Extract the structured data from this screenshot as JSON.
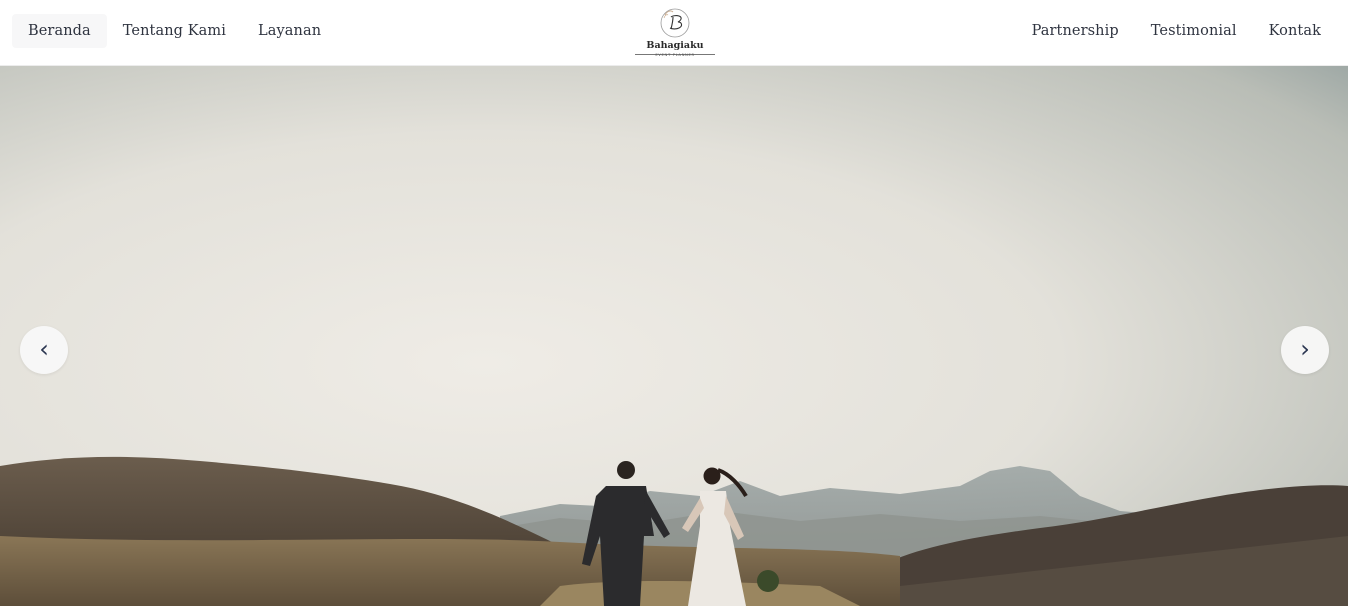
{
  "nav": {
    "left": [
      {
        "label": "Beranda",
        "active": true
      },
      {
        "label": "Tentang Kami",
        "active": false
      },
      {
        "label": "Layanan",
        "active": false
      }
    ],
    "right": [
      {
        "label": "Partnership"
      },
      {
        "label": "Testimonial"
      },
      {
        "label": "Kontak"
      }
    ]
  },
  "logo": {
    "monogram": "B",
    "name": "Bahagiaku",
    "tagline": "EVENT PLANNER"
  },
  "carousel": {
    "prev_glyph": "‹",
    "next_glyph": "›",
    "prev_icon": "chevron-left-icon",
    "next_icon": "chevron-right-icon",
    "slide_image": "bride-and-groom-walking-on-hills-photo"
  },
  "colors": {
    "nav_text": "#2f3440",
    "active_bg": "#f7f7f8",
    "arrow_text": "#2a3550",
    "sky_light": "#ece9e3",
    "sky_right": "#7c8e90"
  }
}
